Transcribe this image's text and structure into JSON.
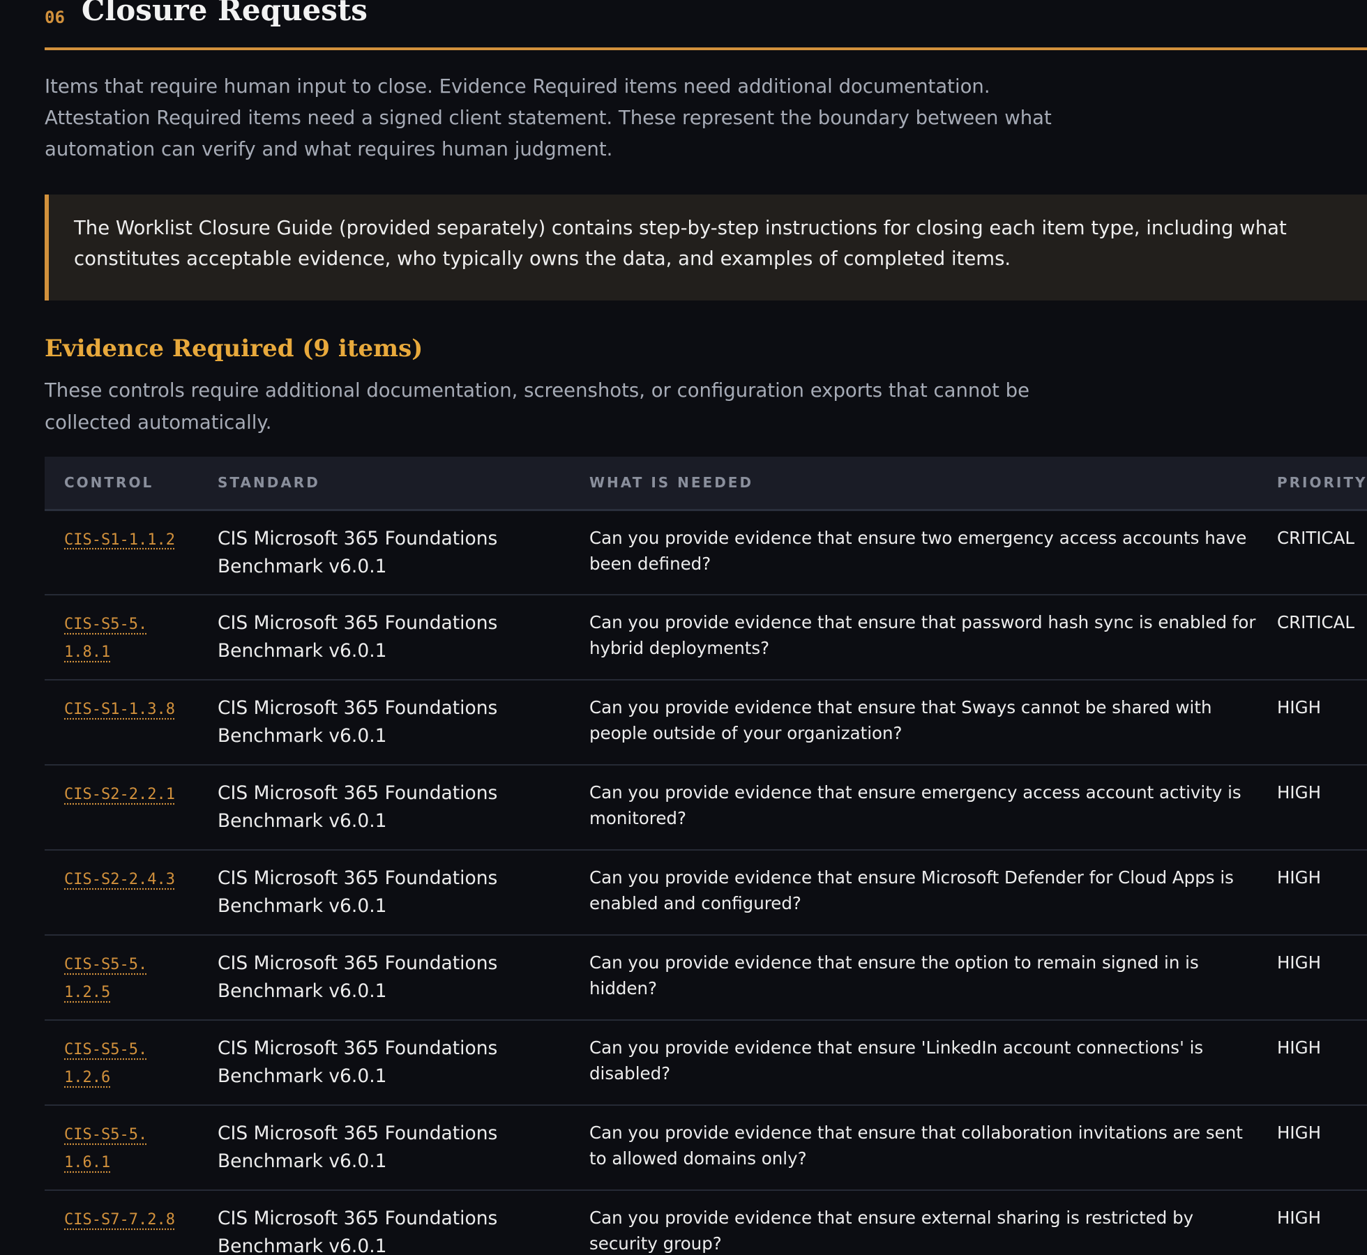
{
  "section": {
    "number": "06",
    "title": "Closure Requests",
    "intro": "Items that require human input to close. Evidence Required items need additional documentation. Attestation Required items need a signed client statement. These represent the boundary between what automation can verify and what requires human judgment."
  },
  "callout": {
    "text": "The Worklist Closure Guide (provided separately) contains step-by-step instructions for closing each item type, including what constitutes acceptable evidence, who typically owns the data, and examples of completed items."
  },
  "evidence": {
    "title": "Evidence Required (9 items)",
    "description": "These controls require additional documentation, screenshots, or configuration exports that cannot be collected automatically.",
    "columns": {
      "control": "CONTROL",
      "standard": "STANDARD",
      "needed": "WHAT IS NEEDED",
      "priority": "PRIORITY"
    },
    "rows": [
      {
        "control": "CIS-S1-1.1.2",
        "standard": "CIS Microsoft 365 Foundations Benchmark v6.0.1",
        "needed": "Can you provide evidence that ensure two emergency access accounts have been defined?",
        "priority": "CRITICAL"
      },
      {
        "control": "CIS-S5-5.1.8.1",
        "standard": "CIS Microsoft 365 Foundations Benchmark v6.0.1",
        "needed": "Can you provide evidence that ensure that password hash sync is enabled for hybrid deployments?",
        "priority": "CRITICAL"
      },
      {
        "control": "CIS-S1-1.3.8",
        "standard": "CIS Microsoft 365 Foundations Benchmark v6.0.1",
        "needed": "Can you provide evidence that ensure that Sways cannot be shared with people outside of your organization?",
        "priority": "HIGH"
      },
      {
        "control": "CIS-S2-2.2.1",
        "standard": "CIS Microsoft 365 Foundations Benchmark v6.0.1",
        "needed": "Can you provide evidence that ensure emergency access account activity is monitored?",
        "priority": "HIGH"
      },
      {
        "control": "CIS-S2-2.4.3",
        "standard": "CIS Microsoft 365 Foundations Benchmark v6.0.1",
        "needed": "Can you provide evidence that ensure Microsoft Defender for Cloud Apps is enabled and configured?",
        "priority": "HIGH"
      },
      {
        "control": "CIS-S5-5.1.2.5",
        "standard": "CIS Microsoft 365 Foundations Benchmark v6.0.1",
        "needed": "Can you provide evidence that ensure the option to remain signed in is hidden?",
        "priority": "HIGH"
      },
      {
        "control": "CIS-S5-5.1.2.6",
        "standard": "CIS Microsoft 365 Foundations Benchmark v6.0.1",
        "needed": "Can you provide evidence that ensure 'LinkedIn account connections' is disabled?",
        "priority": "HIGH"
      },
      {
        "control": "CIS-S5-5.1.6.1",
        "standard": "CIS Microsoft 365 Foundations Benchmark v6.0.1",
        "needed": "Can you provide evidence that ensure that collaboration invitations are sent to allowed domains only?",
        "priority": "HIGH"
      },
      {
        "control": "CIS-S7-7.2.8",
        "standard": "CIS Microsoft 365 Foundations Benchmark v6.0.1",
        "needed": "Can you provide evidence that ensure external sharing is restricted by security group?",
        "priority": "HIGH"
      }
    ]
  }
}
